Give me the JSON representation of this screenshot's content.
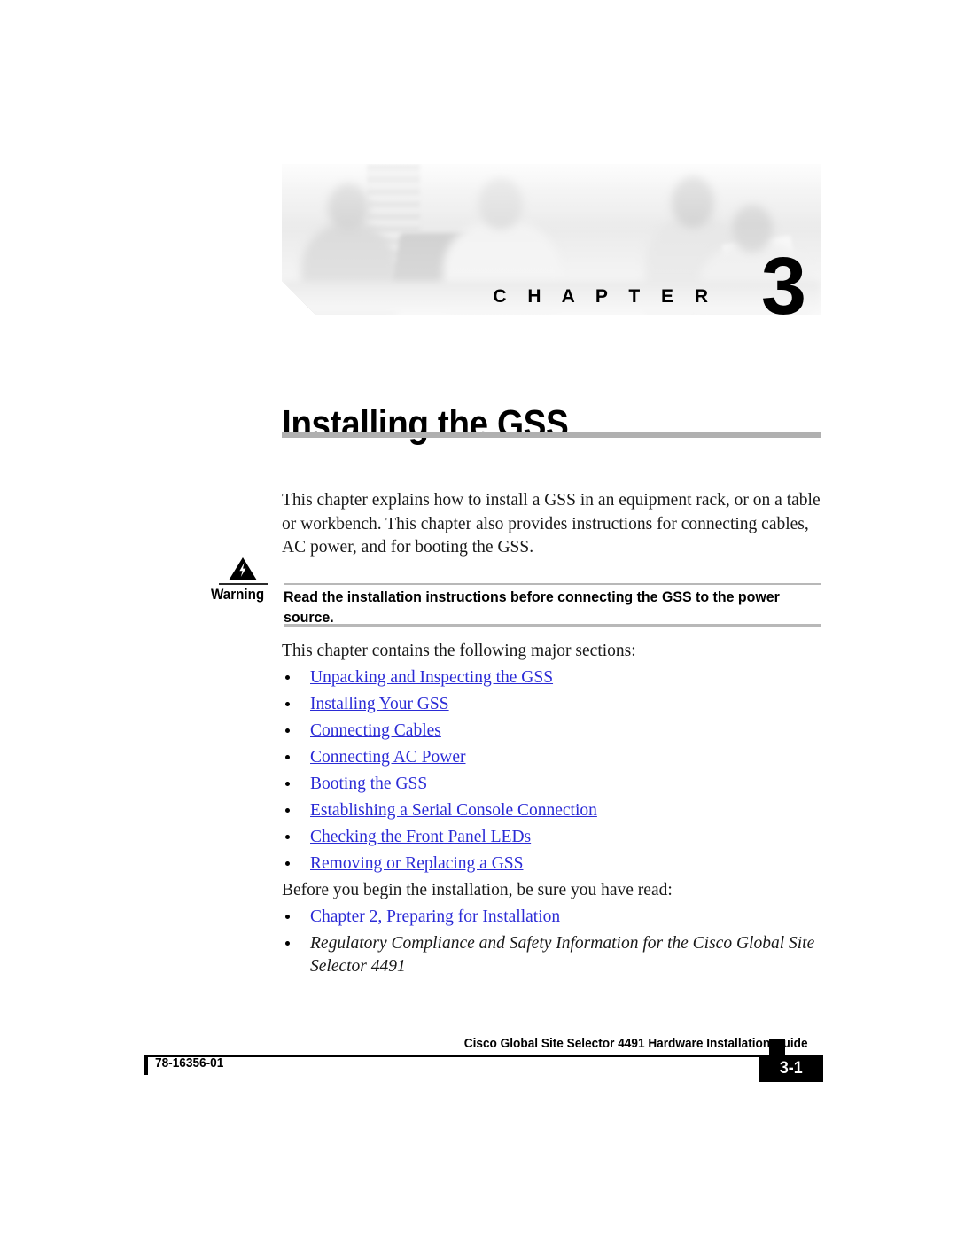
{
  "chapter_banner": {
    "chapter_word": "C H A P T E R",
    "chapter_number": "3",
    "photo_alt": "chapter-banner-photo"
  },
  "title": "Installing the GSS",
  "intro_paragraph": "This chapter explains how to install a GSS in an equipment rack, or on a table or workbench. This chapter also provides instructions for connecting cables, AC power, and for booting the GSS.",
  "warning": {
    "label": "Warning",
    "icon": "warning-triangle-lightning-icon",
    "text": "Read the installation instructions before connecting the GSS to the power source."
  },
  "sections_lead": "This chapter contains the following major sections:",
  "sections": [
    "Unpacking and Inspecting the GSS",
    "Installing Your GSS",
    "Connecting Cables",
    "Connecting AC Power",
    "Booting the GSS",
    "Establishing a Serial Console Connection",
    "Checking the Front Panel LEDs",
    "Removing or Replacing a GSS"
  ],
  "before_lead": "Before you begin the installation, be sure you have read:",
  "before_items": [
    "Chapter 2,  Preparing for Installation",
    "Regulatory Compliance and Safety Information for the Cisco Global Site Selector 4491"
  ],
  "footer": {
    "document_title": "Cisco Global Site Selector 4491 Hardware Installation Guide",
    "document_number": "78-16356-01",
    "page_number": "3-1"
  },
  "colors": {
    "link": "#2b2bd6",
    "rule_gray": "#b0b0b0",
    "text": "#1a1a1a",
    "black": "#000000"
  }
}
